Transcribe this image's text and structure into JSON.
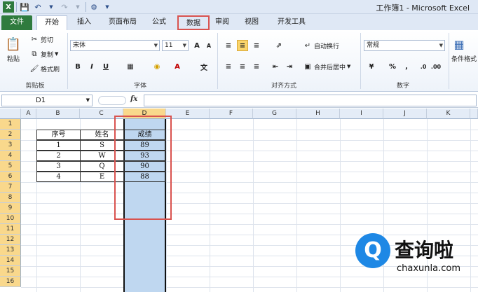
{
  "window": {
    "title": "工作簿1 - Microsoft Excel"
  },
  "tabs": [
    {
      "label": "文件"
    },
    {
      "label": "开始"
    },
    {
      "label": "插入"
    },
    {
      "label": "页面布局"
    },
    {
      "label": "公式"
    },
    {
      "label": "数据"
    },
    {
      "label": "审阅"
    },
    {
      "label": "视图"
    },
    {
      "label": "开发工具"
    }
  ],
  "ribbon": {
    "clipboard": {
      "paste": "粘贴",
      "cut": "剪切",
      "copy": "复制",
      "format_painter": "格式刷",
      "group": "剪贴板"
    },
    "font": {
      "name": "宋体",
      "size": "11",
      "group": "字体",
      "bold": "B",
      "italic": "I",
      "underline": "U",
      "grow": "A",
      "shrink": "A"
    },
    "alignment": {
      "wrap": "自动换行",
      "merge": "合并后居中",
      "group": "对齐方式"
    },
    "number": {
      "format": "常规",
      "percent": "%",
      "comma": ",",
      "group": "数字"
    },
    "styles": {
      "conditional": "条件格式"
    }
  },
  "formula_bar": {
    "name_box": "D1",
    "fx": "fx",
    "value": ""
  },
  "columns": [
    "A",
    "B",
    "C",
    "D",
    "E",
    "F",
    "G",
    "H",
    "I",
    "J",
    "K"
  ],
  "rows": [
    "1",
    "2",
    "3",
    "4",
    "5",
    "6",
    "7",
    "8",
    "9",
    "10",
    "11",
    "12",
    "13",
    "14",
    "15",
    "16"
  ],
  "table": {
    "headers": [
      "序号",
      "姓名",
      "成绩"
    ],
    "rows": [
      [
        "1",
        "S",
        "89"
      ],
      [
        "2",
        "W",
        "93"
      ],
      [
        "3",
        "Q",
        "90"
      ],
      [
        "4",
        "E",
        "88"
      ]
    ]
  },
  "watermark": {
    "logo_letter": "Q",
    "name": "查询啦",
    "url": "chaxunla.com"
  },
  "colors": {
    "file_tab": "#2f7b3e",
    "highlight": "#d9534f",
    "selection": "#bfd7f0",
    "header_selected": "#f9d88c"
  }
}
